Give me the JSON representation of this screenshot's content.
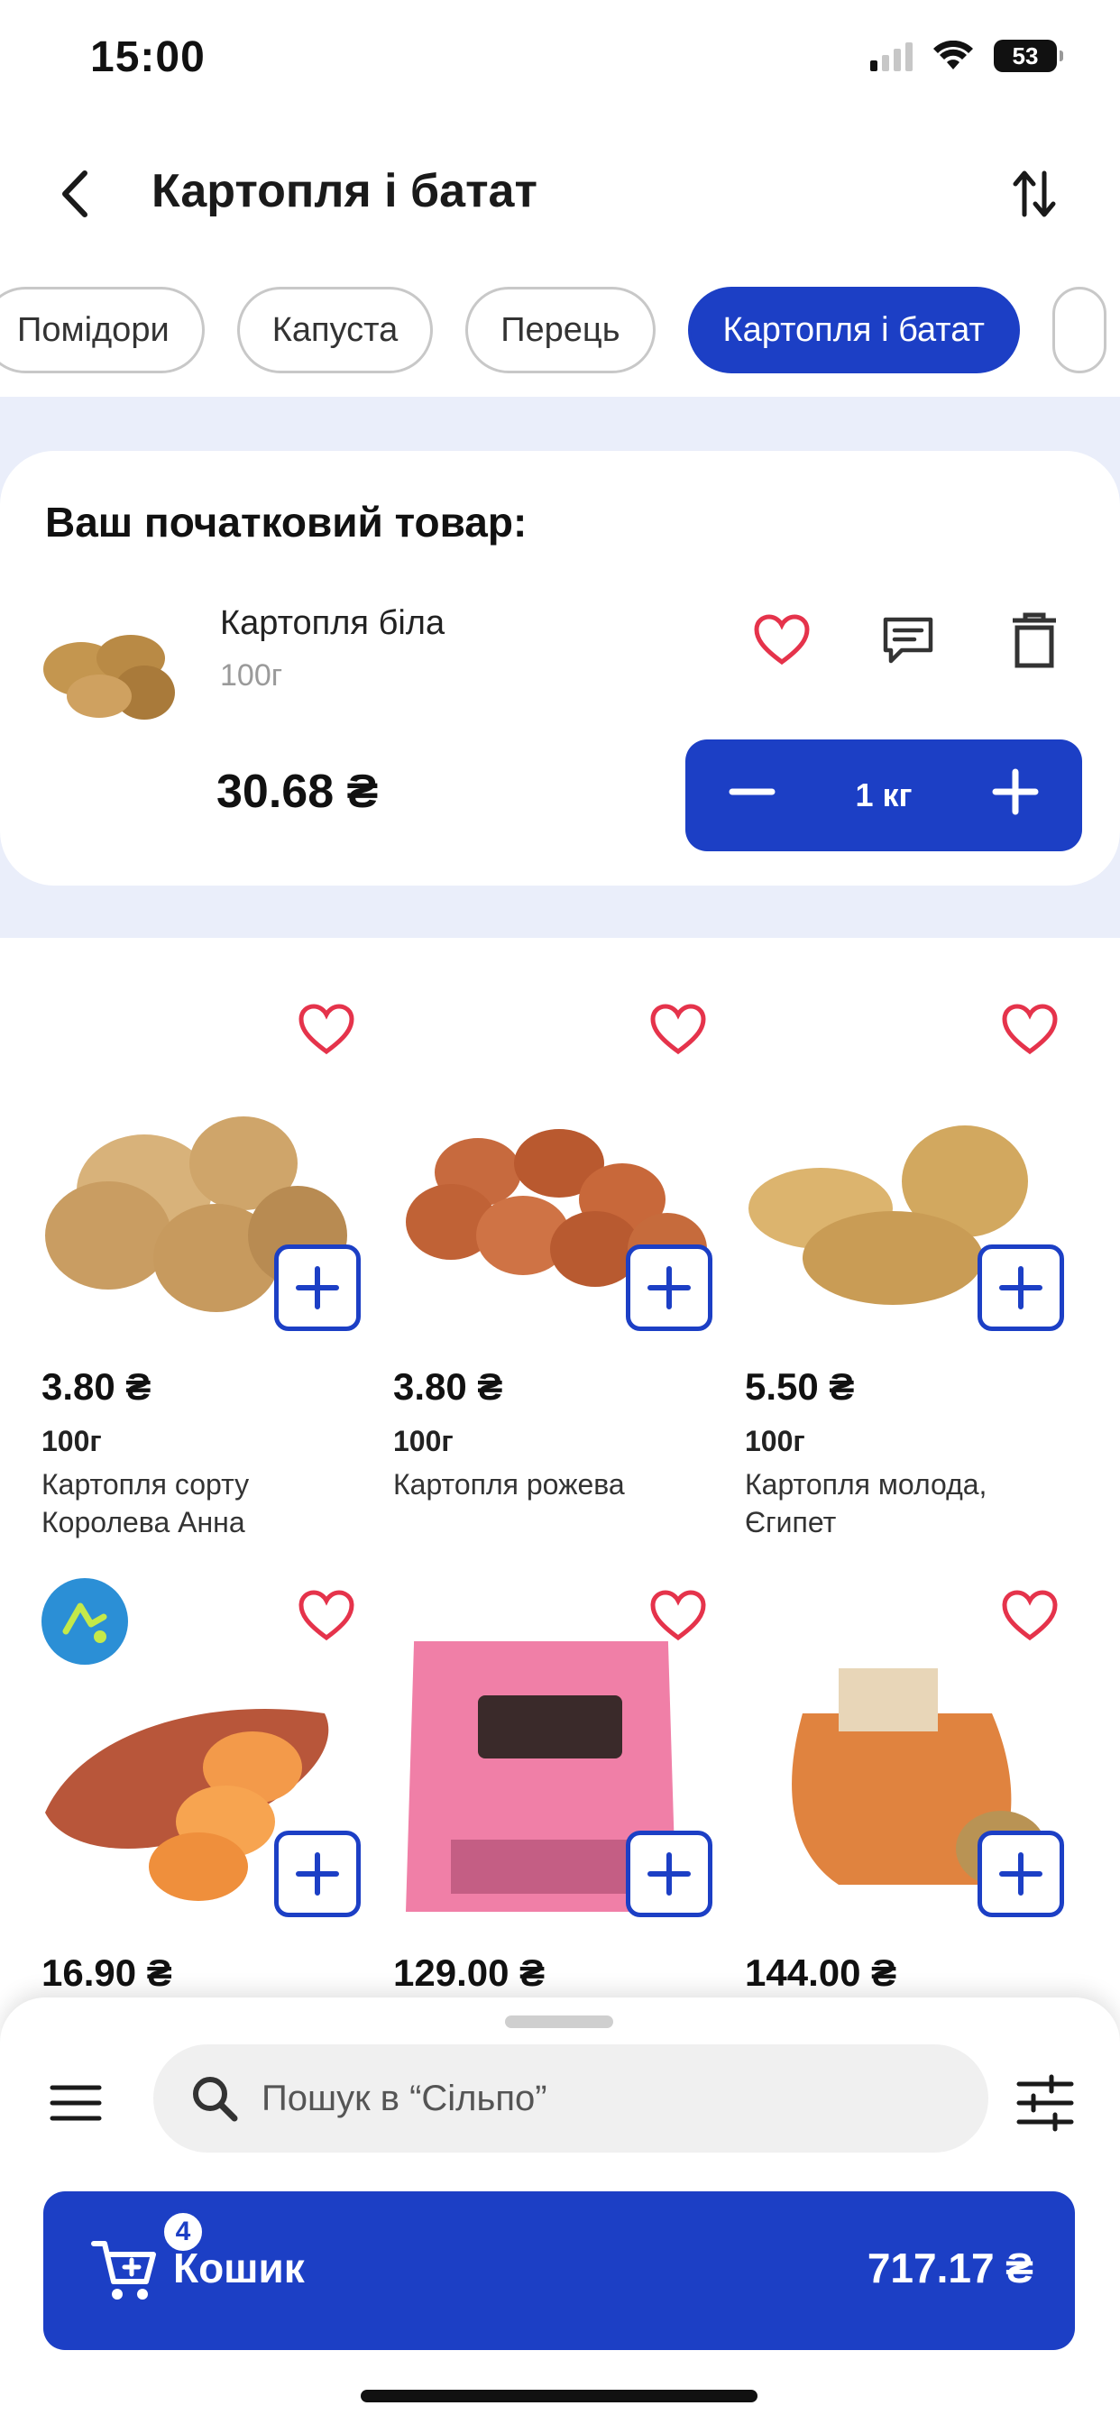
{
  "status": {
    "time": "15:00",
    "battery": "53"
  },
  "header": {
    "title": "Картопля і батат"
  },
  "chips": [
    "Помідори",
    "Капуста",
    "Перець",
    "Картопля і батат"
  ],
  "initial": {
    "title": "Ваш початковий товар:",
    "name": "Картопля біла",
    "weight": "100г",
    "price": "30.68 ₴",
    "qty": "1 кг"
  },
  "products": [
    {
      "price": "3.80 ₴",
      "weight": "100г",
      "name": "Картопля сорту Королева Анна"
    },
    {
      "price": "3.80 ₴",
      "weight": "100г",
      "name": "Картопля рожева"
    },
    {
      "price": "5.50 ₴",
      "weight": "100г",
      "name": "Картопля молода, Єгипет"
    },
    {
      "price": "16.90 ₴"
    },
    {
      "price": "129.00 ₴"
    },
    {
      "price": "144.00 ₴"
    }
  ],
  "search": {
    "placeholder": "Пошук в “Сільпо”"
  },
  "cart": {
    "label": "Кошик",
    "count": "4",
    "total": "717.17 ₴"
  },
  "colors": {
    "accent": "#1c3fc5",
    "heart": "#e5334b",
    "section_bg": "#eaeefa"
  },
  "icons": [
    "back-arrow-icon",
    "sort-icon",
    "heart-icon",
    "comment-icon",
    "trash-icon",
    "plus-icon",
    "minus-icon",
    "menu-icon",
    "search-icon",
    "filter-icon",
    "cart-icon"
  ]
}
